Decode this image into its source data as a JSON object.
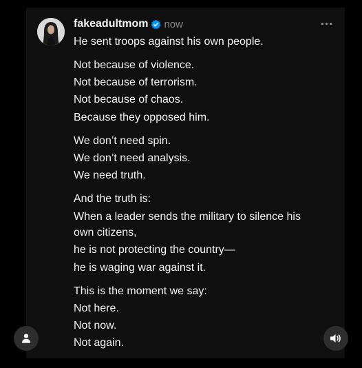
{
  "post": {
    "author": {
      "username": "fakeadultmom",
      "verified": true,
      "avatar_icon": "profile-photo"
    },
    "timestamp": "now",
    "more_icon": "more-options-icon",
    "lines": [
      "He sent troops against his own people.",
      "Not because of violence.",
      "Not because of terrorism.",
      "Not because of chaos.",
      "Because they opposed him.",
      "We don’t need spin.",
      "We don’t need analysis.",
      "We need truth.",
      "And the truth is:",
      "When a leader sends the military to silence his",
      "own citizens,",
      "he is not protecting the country—",
      "he is waging war against it.",
      "This is the moment we say:",
      "Not here.",
      "Not now.",
      "Not again."
    ]
  },
  "controls": {
    "user_icon": "user-icon",
    "sound_icon": "speaker-icon"
  },
  "colors": {
    "background": "#000000",
    "card": "#101010",
    "text": "#f5f5f5",
    "muted": "#8a8a8a",
    "verified": "#0095f6",
    "button": "#2e2e2e"
  }
}
